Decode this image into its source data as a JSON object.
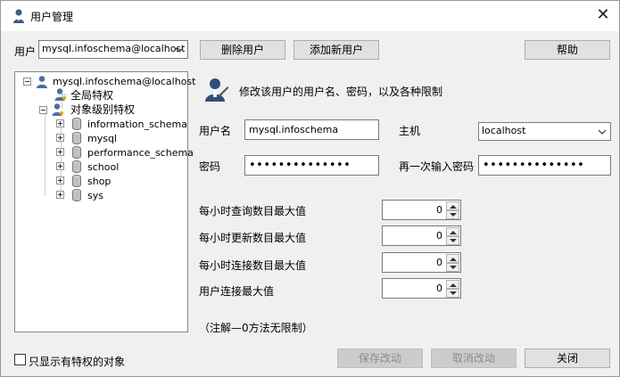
{
  "window": {
    "title": "用户管理",
    "close_glyph": "✕"
  },
  "toolbar": {
    "user_label": "用户",
    "user_value": "mysql.infoschema@localhost",
    "delete_label": "删除用户",
    "add_label": "添加新用户",
    "help_label": "帮助"
  },
  "tree": {
    "root": "mysql.infoschema@localhost",
    "global": "全局特权",
    "object": "对象级别特权",
    "databases": [
      "information_schema",
      "mysql",
      "performance_schema",
      "school",
      "shop",
      "sys"
    ]
  },
  "form": {
    "header": "修改该用户的用户名、密码，以及各种限制",
    "username_label": "用户名",
    "username_value": "mysql.infoschema",
    "host_label": "主机",
    "host_value": "localhost",
    "password_label": "密码",
    "password_value": "••••••••••••••",
    "confirm_label": "再一次输入密码",
    "confirm_value": "••••••••••••••",
    "limits": [
      {
        "label": "每小时查询数目最大值",
        "value": "0"
      },
      {
        "label": "每小时更新数目最大值",
        "value": "0"
      },
      {
        "label": "每小时连接数目最大值",
        "value": "0"
      },
      {
        "label": "用户连接最大值",
        "value": "0"
      }
    ],
    "note": "（注解—0方法无限制）"
  },
  "footer": {
    "checkbox_label": "只显示有特权的对象",
    "save_label": "保存改动",
    "cancel_label": "取消改动",
    "close_label": "关闭"
  },
  "icons": {
    "title": "user-icon",
    "close": "close-icon",
    "dropdown": "chevron-down-icon",
    "database": "database-icon"
  },
  "colors": {
    "disabled_button": "#cccccc",
    "window_bg": "#f0f0f0"
  }
}
